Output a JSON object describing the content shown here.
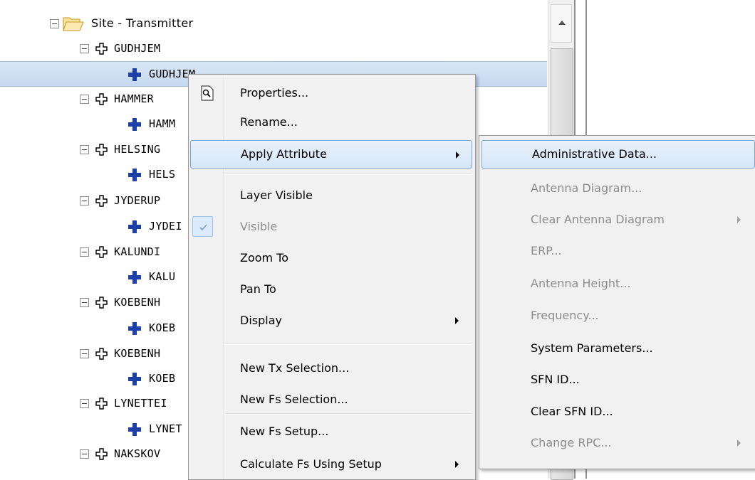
{
  "tree": {
    "root_label": "Site - Transmitter",
    "sites": [
      {
        "parent": "GUDHJEM",
        "child": "GUDHJEM"
      },
      {
        "parent": "HAMMER",
        "child": "HAMM"
      },
      {
        "parent": "HELSING",
        "child": "HELS"
      },
      {
        "parent": "JYDERUP",
        "child": "JYDEI"
      },
      {
        "parent": "KALUNDI",
        "child": "KALU"
      },
      {
        "parent": "KOEBENH",
        "child": "KOEB"
      },
      {
        "parent": "KOEBENH",
        "child": "KOEB"
      },
      {
        "parent": "LYNETTEI",
        "child": "LYNET"
      },
      {
        "parent": "NAKSKOV",
        "child": ""
      }
    ],
    "selected_index": 0
  },
  "context_menu": {
    "items": [
      {
        "label": "Properties...",
        "icon": "properties-icon"
      },
      {
        "label": "Rename..."
      },
      {
        "label": "Apply Attribute",
        "submenu": true
      },
      {
        "label": "Layer Visible"
      },
      {
        "label": "Visible",
        "checked": true,
        "disabled": true
      },
      {
        "label": "Zoom To"
      },
      {
        "label": "Pan To"
      },
      {
        "label": "Display",
        "submenu": true
      },
      {
        "label": "New Tx Selection..."
      },
      {
        "label": "New Fs Selection..."
      },
      {
        "label": "New Fs Setup..."
      },
      {
        "label": "Calculate Fs Using Setup",
        "submenu": true
      }
    ]
  },
  "submenu": {
    "items": [
      {
        "label": "Administrative Data..."
      },
      {
        "label": "Antenna Diagram...",
        "disabled": true
      },
      {
        "label": "Clear Antenna Diagram",
        "disabled": true,
        "submenu": true
      },
      {
        "label": "ERP...",
        "disabled": true
      },
      {
        "label": "Antenna Height...",
        "disabled": true
      },
      {
        "label": "Frequency...",
        "disabled": true
      },
      {
        "label": "System Parameters..."
      },
      {
        "label": "SFN ID..."
      },
      {
        "label": "Clear SFN ID..."
      },
      {
        "label": "Change RPC...",
        "disabled": true,
        "submenu": true
      }
    ]
  },
  "colors": {
    "selection": "#c4d8ee",
    "cross_blue": "#1c3fa8",
    "menu_bg": "#f1f1f1",
    "disabled_text": "#8c8c8c"
  }
}
